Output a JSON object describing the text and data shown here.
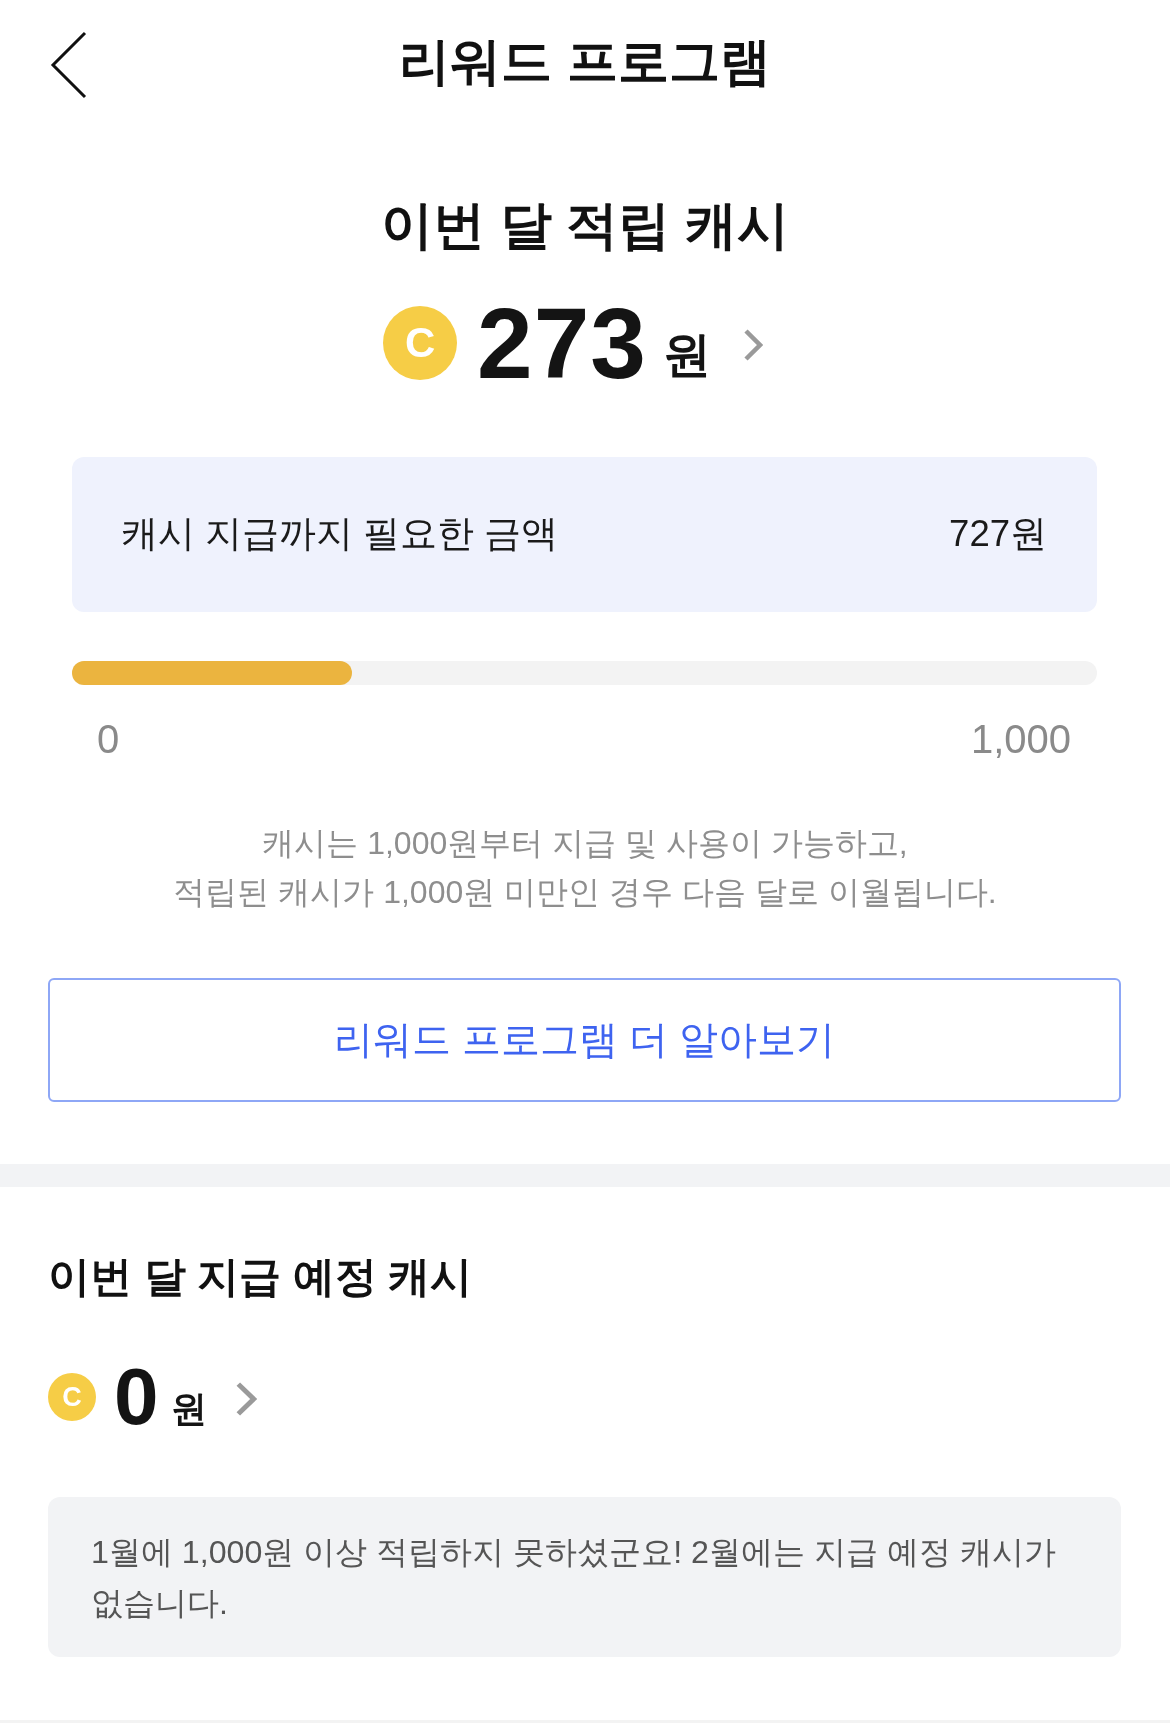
{
  "header": {
    "title": "리워드 프로그램"
  },
  "accrued": {
    "title": "이번 달 적립 캐시",
    "coin": "C",
    "amount": "273",
    "unit": "원"
  },
  "needed": {
    "label": "캐시 지급까지 필요한 금액",
    "value": "727원"
  },
  "progress": {
    "level": 0.273,
    "min": "0",
    "max": "1,000"
  },
  "notice": [
    "캐시는 1,000원부터 지급 및 사용이 가능하고,",
    "적립된 캐시가 1,000원 미만인 경우 다음 달로 이월됩니다."
  ],
  "more_button": {
    "label": "리워드 프로그램 더 알아보기"
  },
  "scheduled": {
    "title": "이번 달 지급 예정 캐시",
    "coin": "C",
    "amount": "0",
    "unit": "원",
    "message": "1월에 1,000원 이상 적립하지 못하셨군요! 2월에는 지급 예정 캐시가 없습니다."
  }
}
